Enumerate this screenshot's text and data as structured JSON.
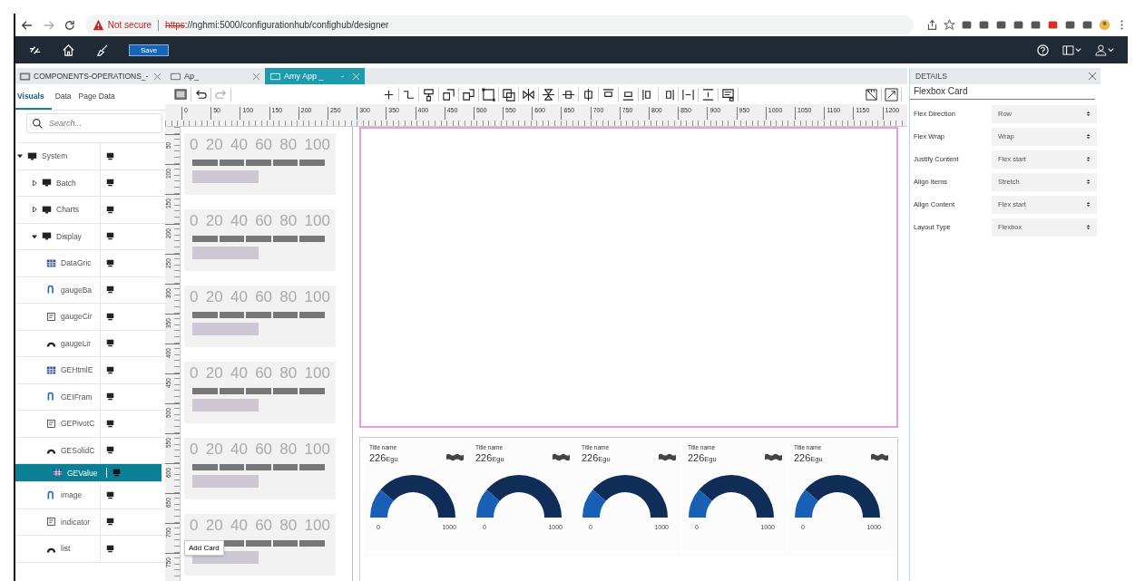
{
  "browser": {
    "security": "Not secure",
    "url_scheme": "https",
    "url_rest": "://nghmi:5000/configurationhub/confighub/designer"
  },
  "app_header": {
    "save_label": "Save"
  },
  "left_panel": {
    "tab_title": "COMPONENTS-OPERATIONS_-",
    "tabs": [
      {
        "label": "Visuals",
        "selected": true
      },
      {
        "label": "Data",
        "selected": false
      },
      {
        "label": "Page Data",
        "selected": false
      }
    ],
    "search": {
      "placeholder": "Search..."
    },
    "tree": [
      {
        "label": "System",
        "expanded": true,
        "selected": false,
        "children": [
          {
            "label": "Batch",
            "expanded": false,
            "selected": false
          },
          {
            "label": "Charts",
            "expanded": false,
            "selected": false
          },
          {
            "label": "Display",
            "expanded": true,
            "selected": false,
            "children": [
              {
                "label": "DataGric",
                "selected": false
              },
              {
                "label": "gaugeBa",
                "selected": false
              },
              {
                "label": "gaugeCir",
                "selected": false
              },
              {
                "label": "gaugeLir",
                "selected": false
              },
              {
                "label": "GEHtmlE",
                "selected": false
              },
              {
                "label": "GEIFram",
                "selected": false
              },
              {
                "label": "GEPivotC",
                "selected": false
              },
              {
                "label": "GESolidC",
                "selected": false
              },
              {
                "label": "GEValue",
                "selected": true
              },
              {
                "label": "image",
                "selected": false
              },
              {
                "label": "indicator",
                "selected": false
              },
              {
                "label": "list",
                "selected": false
              }
            ]
          }
        ]
      }
    ]
  },
  "doc_tabs": [
    {
      "label": "Ap_",
      "selected": false
    },
    {
      "label": "Amy App _",
      "selected": true,
      "minimize": "-"
    }
  ],
  "ruler": {
    "horizontal": [
      "0",
      "50",
      "100",
      "150",
      "200",
      "250",
      "300",
      "350",
      "400",
      "450",
      "500",
      "550",
      "600",
      "650",
      "700",
      "750",
      "800",
      "850",
      "900",
      "950",
      "1000",
      "1050",
      "1100",
      "1150",
      "1200"
    ],
    "vertical": [
      "50",
      "100",
      "150",
      "200",
      "250",
      "300",
      "350",
      "400",
      "450",
      "500",
      "550",
      "600",
      "650",
      "700",
      "750"
    ]
  },
  "card_templates": [
    {
      "scale": [
        "0",
        "20",
        "40",
        "60",
        "80",
        "100"
      ]
    },
    {
      "scale": [
        "0",
        "20",
        "40",
        "60",
        "80",
        "100"
      ]
    },
    {
      "scale": [
        "0",
        "20",
        "40",
        "60",
        "80",
        "100"
      ]
    },
    {
      "scale": [
        "0",
        "20",
        "40",
        "60",
        "80",
        "100"
      ]
    },
    {
      "scale": [
        "0",
        "20",
        "40",
        "60",
        "80",
        "100"
      ]
    },
    {
      "scale": [
        "0",
        "20",
        "40",
        "60",
        "80",
        "100"
      ]
    }
  ],
  "tooltip": "Add Card",
  "gauges": [
    {
      "title": "Title name",
      "value": "226",
      "unit": "Egu",
      "min": "0",
      "max": "1000",
      "level": 0.226
    },
    {
      "title": "Title name",
      "value": "226",
      "unit": "Egu",
      "min": "0",
      "max": "1000",
      "level": 0.226
    },
    {
      "title": "Title name",
      "value": "226",
      "unit": "Egu",
      "min": "0",
      "max": "1000",
      "level": 0.226
    },
    {
      "title": "Title name",
      "value": "226",
      "unit": "Egu",
      "min": "0",
      "max": "1000",
      "level": 0.226
    },
    {
      "title": "Title name",
      "value": "226",
      "unit": "Egu",
      "min": "0",
      "max": "1000",
      "level": 0.226
    }
  ],
  "details": {
    "title": "DETAILS",
    "component": "Flexbox Card",
    "properties": [
      {
        "label": "Flex Direction",
        "value": "Row"
      },
      {
        "label": "Flex Wrap",
        "value": "Wrap"
      },
      {
        "label": "Justify Content",
        "value": "Flex start"
      },
      {
        "label": "Align Items",
        "value": "Stretch"
      },
      {
        "label": "Align Content",
        "value": "Flex start"
      },
      {
        "label": "Layout Type",
        "value": "Flexbox"
      }
    ]
  }
}
